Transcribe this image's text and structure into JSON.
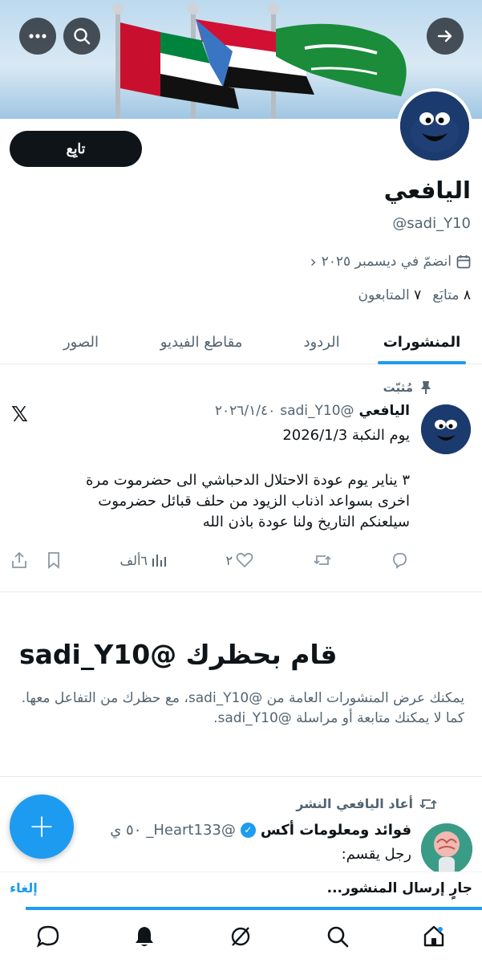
{
  "profile": {
    "display_name": "اليافعي",
    "handle": "@sadi_Y10",
    "joined": "انضمّ في ديسمبر ٢٠٢٥",
    "following_count": "٨",
    "following_label": "متابَع",
    "followers_count": "٧",
    "followers_label": "المتابعون",
    "follow_label": "تابِع"
  },
  "tabs": [
    {
      "label": "المنشورات",
      "active": true
    },
    {
      "label": "الردود"
    },
    {
      "label": "مقاطع الفيديو"
    },
    {
      "label": "الصور"
    }
  ],
  "pinned_post": {
    "pinned_label": "مُثبّت",
    "author": "اليافعي",
    "handle": "@sadi_Y10",
    "date": "٢٠٢٦/١/٤٠",
    "line1": "يوم النكبة 2026/1/3",
    "body": "٣ يناير يوم عودة الاحتلال الدحباشي الى حضرموت مرة\nاخرى بسواعد اذناب الزيود من حلف قبائل حضرموت\nسيلعنكم التاريخ ولنا عودة باذن الله",
    "likes": "٢",
    "views": "٦ألف"
  },
  "blocked": {
    "title": "قام بحظرك @sadi_Y10",
    "description": "يمكنك عرض المنشورات العامة من @sadi_Y10، مع حظرك من التفاعل معها. كما لا يمكنك متابعة أو مراسلة @sadi_Y10."
  },
  "retweet": {
    "label": "أعاد اليافعي النشر",
    "author": "فوائد ومعلومات أكس",
    "handle": "@Heart133_",
    "time": "٥٠ ي",
    "text": "رجل يقسم:"
  },
  "sending": {
    "message": "جارٍ إرسال المنشور...",
    "cancel": "إلغاء",
    "progress": 0.95
  },
  "colors": {
    "accent": "#1d9bf0",
    "text": "#0f1419",
    "muted": "#536471"
  }
}
